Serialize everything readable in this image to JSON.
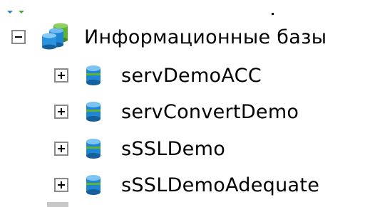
{
  "tree": {
    "root": {
      "label": "Информационные базы",
      "icon": "databases-icon",
      "expanded": true
    },
    "items": [
      {
        "label": "servDemoACC",
        "icon": "database-icon",
        "expanded": false
      },
      {
        "label": "servConvertDemo",
        "icon": "database-icon",
        "expanded": false
      },
      {
        "label": "sSSLDemo",
        "icon": "database-icon",
        "expanded": false
      },
      {
        "label": "sSSLDemoAdequate",
        "icon": "database-icon",
        "expanded": false
      }
    ]
  },
  "colors": {
    "expander_border": "#8a8a8a",
    "db_blue": "#1f86d4",
    "db_green": "#5fb233"
  }
}
